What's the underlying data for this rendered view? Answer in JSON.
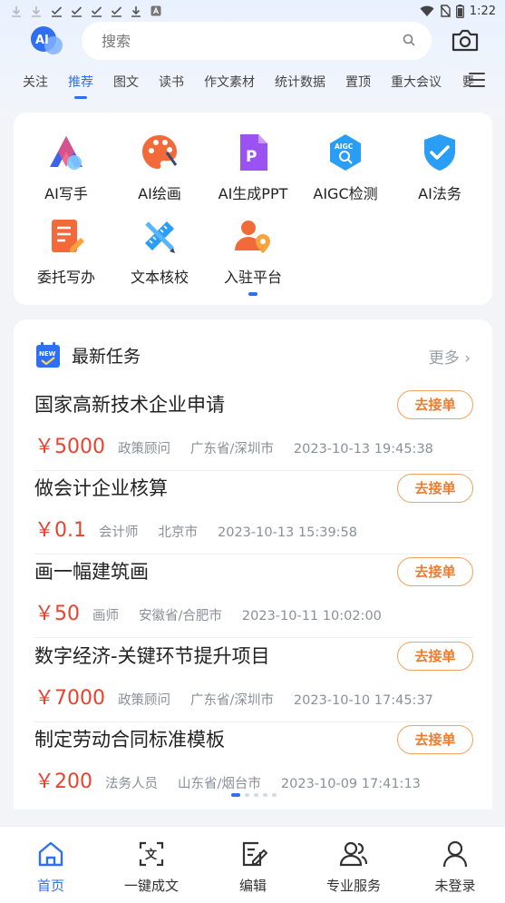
{
  "status_bar": {
    "time": "1:22"
  },
  "search": {
    "placeholder": "搜索"
  },
  "tabs": [
    "关注",
    "推荐",
    "图文",
    "读书",
    "作文素材",
    "统计数据",
    "置顶",
    "重大会议",
    "要"
  ],
  "services": [
    {
      "label": "AI写手",
      "icon": "ai-writer-icon"
    },
    {
      "label": "AI绘画",
      "icon": "palette-icon"
    },
    {
      "label": "AI生成PPT",
      "icon": "ppt-icon"
    },
    {
      "label": "AIGC检测",
      "icon": "aigc-detect-icon"
    },
    {
      "label": "AI法务",
      "icon": "shield-check-icon"
    },
    {
      "label": "委托写办",
      "icon": "document-edit-icon"
    },
    {
      "label": "文本核校",
      "icon": "ruler-pencil-icon"
    },
    {
      "label": "入驻平台",
      "icon": "user-location-icon"
    }
  ],
  "tasks_section": {
    "title": "最新任务",
    "more": "更多",
    "badge": "NEW"
  },
  "tasks": [
    {
      "name": "国家高新技术企业申请",
      "price": "￥5000",
      "role": "政策顾问",
      "location": "广东省/深圳市",
      "time": "2023-10-13 19:45:38",
      "action": "去接单"
    },
    {
      "name": "做会计企业核算",
      "price": "￥0.1",
      "role": "会计师",
      "location": "北京市",
      "time": "2023-10-13 15:39:58",
      "action": "去接单"
    },
    {
      "name": "画一幅建筑画",
      "price": "￥50",
      "role": "画师",
      "location": "安徽省/合肥市",
      "time": "2023-10-11 10:02:00",
      "action": "去接单"
    },
    {
      "name": "数字经济-关键环节提升项目",
      "price": "￥7000",
      "role": "政策顾问",
      "location": "广东省/深圳市",
      "time": "2023-10-10 17:45:37",
      "action": "去接单"
    },
    {
      "name": "制定劳动合同标准模板",
      "price": "￥200",
      "role": "法务人员",
      "location": "山东省/烟台市",
      "time": "2023-10-09 17:41:13",
      "action": "去接单"
    }
  ],
  "bottom_nav": [
    {
      "label": "首页",
      "icon": "home-icon"
    },
    {
      "label": "一键成文",
      "icon": "scan-text-icon"
    },
    {
      "label": "编辑",
      "icon": "edit-icon"
    },
    {
      "label": "专业服务",
      "icon": "users-icon"
    },
    {
      "label": "未登录",
      "icon": "user-icon"
    }
  ],
  "colors": {
    "accent": "#2f6ff1",
    "price": "#e8432f",
    "action": "#f07b2c"
  }
}
